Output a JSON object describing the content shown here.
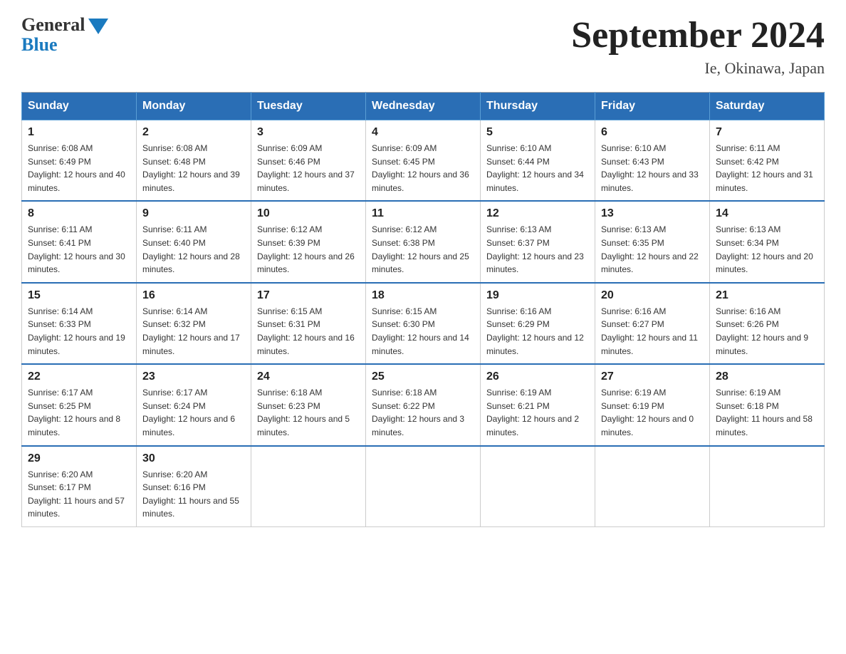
{
  "header": {
    "logo_general": "General",
    "logo_blue": "Blue",
    "month_title": "September 2024",
    "location": "Ie, Okinawa, Japan"
  },
  "weekdays": [
    "Sunday",
    "Monday",
    "Tuesday",
    "Wednesday",
    "Thursday",
    "Friday",
    "Saturday"
  ],
  "weeks": [
    [
      {
        "day": "1",
        "sunrise": "6:08 AM",
        "sunset": "6:49 PM",
        "daylight": "12 hours and 40 minutes."
      },
      {
        "day": "2",
        "sunrise": "6:08 AM",
        "sunset": "6:48 PM",
        "daylight": "12 hours and 39 minutes."
      },
      {
        "day": "3",
        "sunrise": "6:09 AM",
        "sunset": "6:46 PM",
        "daylight": "12 hours and 37 minutes."
      },
      {
        "day": "4",
        "sunrise": "6:09 AM",
        "sunset": "6:45 PM",
        "daylight": "12 hours and 36 minutes."
      },
      {
        "day": "5",
        "sunrise": "6:10 AM",
        "sunset": "6:44 PM",
        "daylight": "12 hours and 34 minutes."
      },
      {
        "day": "6",
        "sunrise": "6:10 AM",
        "sunset": "6:43 PM",
        "daylight": "12 hours and 33 minutes."
      },
      {
        "day": "7",
        "sunrise": "6:11 AM",
        "sunset": "6:42 PM",
        "daylight": "12 hours and 31 minutes."
      }
    ],
    [
      {
        "day": "8",
        "sunrise": "6:11 AM",
        "sunset": "6:41 PM",
        "daylight": "12 hours and 30 minutes."
      },
      {
        "day": "9",
        "sunrise": "6:11 AM",
        "sunset": "6:40 PM",
        "daylight": "12 hours and 28 minutes."
      },
      {
        "day": "10",
        "sunrise": "6:12 AM",
        "sunset": "6:39 PM",
        "daylight": "12 hours and 26 minutes."
      },
      {
        "day": "11",
        "sunrise": "6:12 AM",
        "sunset": "6:38 PM",
        "daylight": "12 hours and 25 minutes."
      },
      {
        "day": "12",
        "sunrise": "6:13 AM",
        "sunset": "6:37 PM",
        "daylight": "12 hours and 23 minutes."
      },
      {
        "day": "13",
        "sunrise": "6:13 AM",
        "sunset": "6:35 PM",
        "daylight": "12 hours and 22 minutes."
      },
      {
        "day": "14",
        "sunrise": "6:13 AM",
        "sunset": "6:34 PM",
        "daylight": "12 hours and 20 minutes."
      }
    ],
    [
      {
        "day": "15",
        "sunrise": "6:14 AM",
        "sunset": "6:33 PM",
        "daylight": "12 hours and 19 minutes."
      },
      {
        "day": "16",
        "sunrise": "6:14 AM",
        "sunset": "6:32 PM",
        "daylight": "12 hours and 17 minutes."
      },
      {
        "day": "17",
        "sunrise": "6:15 AM",
        "sunset": "6:31 PM",
        "daylight": "12 hours and 16 minutes."
      },
      {
        "day": "18",
        "sunrise": "6:15 AM",
        "sunset": "6:30 PM",
        "daylight": "12 hours and 14 minutes."
      },
      {
        "day": "19",
        "sunrise": "6:16 AM",
        "sunset": "6:29 PM",
        "daylight": "12 hours and 12 minutes."
      },
      {
        "day": "20",
        "sunrise": "6:16 AM",
        "sunset": "6:27 PM",
        "daylight": "12 hours and 11 minutes."
      },
      {
        "day": "21",
        "sunrise": "6:16 AM",
        "sunset": "6:26 PM",
        "daylight": "12 hours and 9 minutes."
      }
    ],
    [
      {
        "day": "22",
        "sunrise": "6:17 AM",
        "sunset": "6:25 PM",
        "daylight": "12 hours and 8 minutes."
      },
      {
        "day": "23",
        "sunrise": "6:17 AM",
        "sunset": "6:24 PM",
        "daylight": "12 hours and 6 minutes."
      },
      {
        "day": "24",
        "sunrise": "6:18 AM",
        "sunset": "6:23 PM",
        "daylight": "12 hours and 5 minutes."
      },
      {
        "day": "25",
        "sunrise": "6:18 AM",
        "sunset": "6:22 PM",
        "daylight": "12 hours and 3 minutes."
      },
      {
        "day": "26",
        "sunrise": "6:19 AM",
        "sunset": "6:21 PM",
        "daylight": "12 hours and 2 minutes."
      },
      {
        "day": "27",
        "sunrise": "6:19 AM",
        "sunset": "6:19 PM",
        "daylight": "12 hours and 0 minutes."
      },
      {
        "day": "28",
        "sunrise": "6:19 AM",
        "sunset": "6:18 PM",
        "daylight": "11 hours and 58 minutes."
      }
    ],
    [
      {
        "day": "29",
        "sunrise": "6:20 AM",
        "sunset": "6:17 PM",
        "daylight": "11 hours and 57 minutes."
      },
      {
        "day": "30",
        "sunrise": "6:20 AM",
        "sunset": "6:16 PM",
        "daylight": "11 hours and 55 minutes."
      },
      null,
      null,
      null,
      null,
      null
    ]
  ]
}
